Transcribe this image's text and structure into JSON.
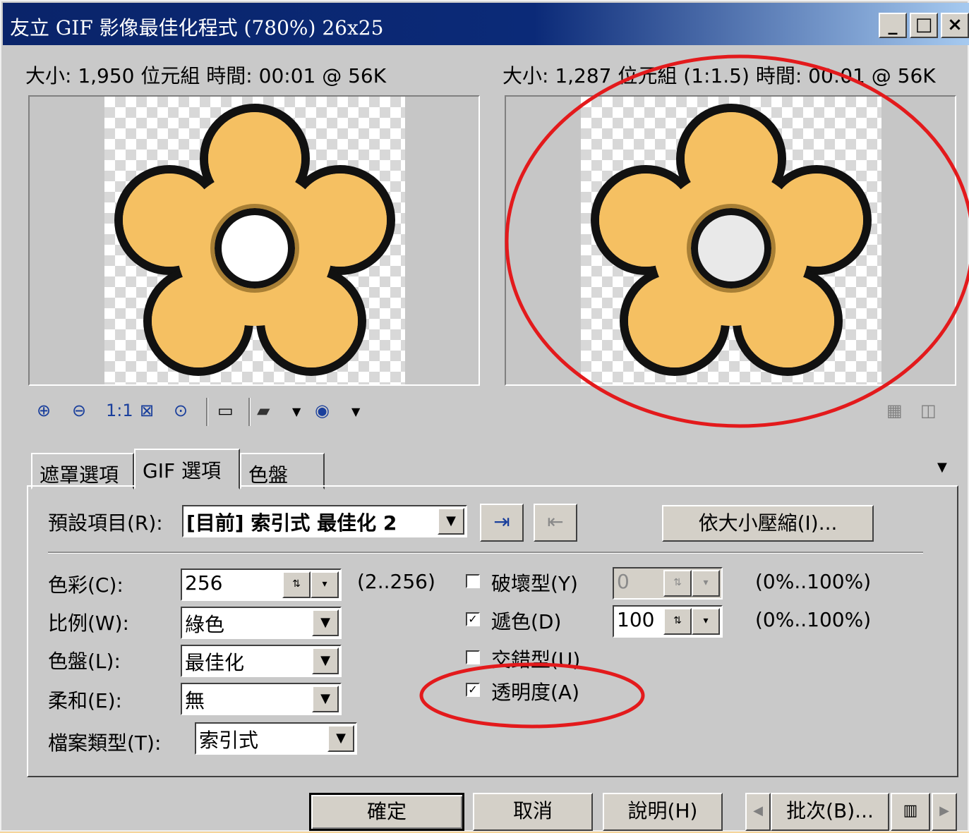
{
  "window": {
    "title": "友立 GIF 影像最佳化程式 (780%) 26x25",
    "controls": {
      "minimize": "_",
      "maximize": "□",
      "close": "×"
    }
  },
  "preview": {
    "left_info": "大小: 1,950 位元組 時間: 00:01 @ 56K",
    "right_info": "大小: 1,287 位元組 (1:1.5) 時間: 00:01 @ 56K"
  },
  "toolbar": {
    "one_to_one": "1:1"
  },
  "tabs": [
    "遮罩選項",
    "GIF 選項",
    "色盤"
  ],
  "active_tab": "GIF 選項",
  "presets": {
    "label": "預設項目(R):",
    "value": "[目前] 索引式 最佳化 2",
    "compress_button": "依大小壓縮(I)..."
  },
  "left_fields": [
    {
      "label": "色彩(C):",
      "value": "256",
      "range": "(2..256)"
    },
    {
      "label": "比例(W):",
      "value": "綠色"
    },
    {
      "label": "色盤(L):",
      "value": "最佳化"
    },
    {
      "label": "柔和(E):",
      "value": "無"
    },
    {
      "label": "檔案類型(T):",
      "value": "索引式"
    }
  ],
  "options": [
    {
      "label": "破壞型(Y)",
      "checked": false,
      "value": "0",
      "range": "(0%..100%)"
    },
    {
      "label": "遞色(D)",
      "checked": true,
      "value": "100",
      "range": "(0%..100%)"
    },
    {
      "label": "交錯型(U)",
      "checked": false
    },
    {
      "label": "透明度(A)",
      "checked": true
    }
  ],
  "buttons": {
    "ok": "確定",
    "cancel": "取消",
    "help": "說明(H)",
    "batch": "批次(B)..."
  },
  "annotation_color": "#e31a1c"
}
